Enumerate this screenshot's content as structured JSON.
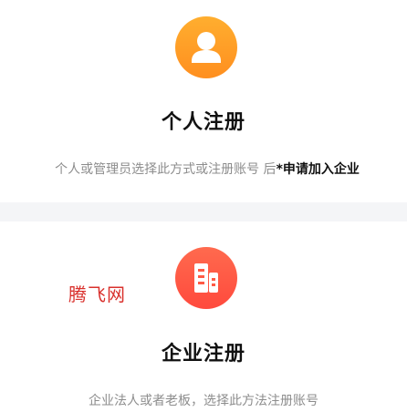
{
  "personal": {
    "icon": "user-icon",
    "title": "个人注册",
    "description": "个人或管理员选择此方式或注册账号 后",
    "description_highlight": "*申请加入企业",
    "accent_color": "#ff9f26"
  },
  "enterprise": {
    "icon": "building-icon",
    "title": "企业注册",
    "description": "企业法人或者老板，选择此方法注册账号",
    "accent_color": "#ff5a45"
  },
  "watermark": {
    "text": "腾飞网",
    "color": "#d9302c"
  },
  "separator_color": "#f4f5f7"
}
